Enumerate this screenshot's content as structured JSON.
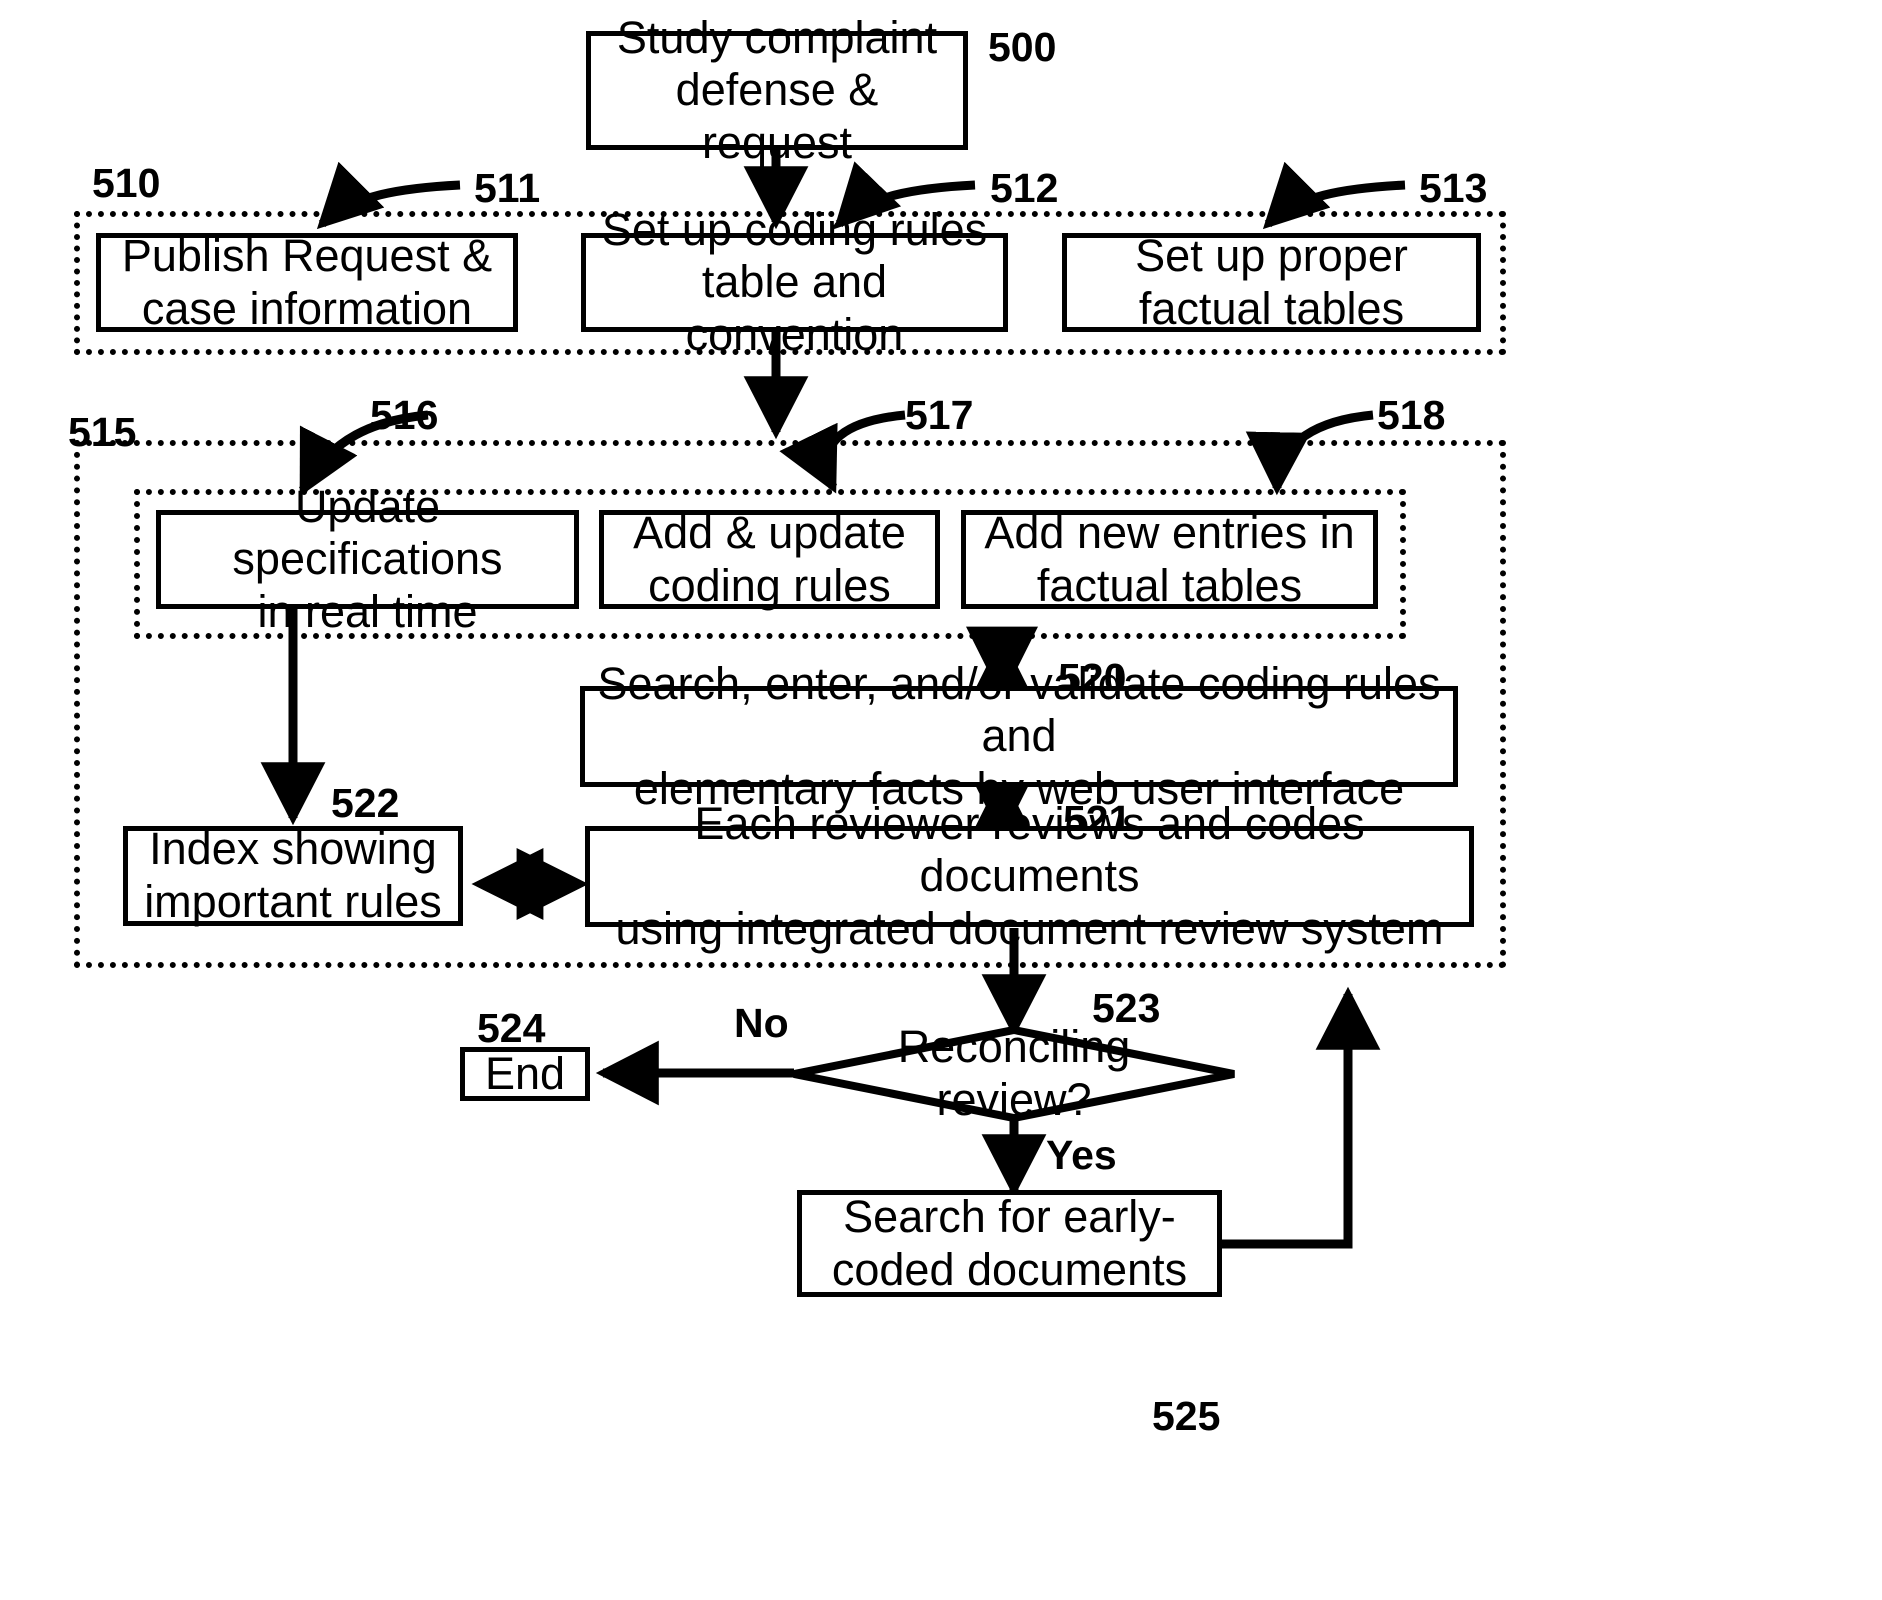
{
  "diagram": {
    "figure_number": "500",
    "nodes": {
      "start": {
        "ref": "500",
        "text": "Study complaint\ndefense & request"
      },
      "n511": {
        "ref": "511",
        "text": "Publish Request &\ncase information"
      },
      "n512": {
        "ref": "512",
        "text": "Set up coding rules\ntable and convention"
      },
      "n513": {
        "ref": "513",
        "text": "Set up proper\nfactual tables"
      },
      "n516": {
        "ref": "516",
        "text": "Update specifications\nin real time"
      },
      "n517": {
        "ref": "517",
        "text": "Add & update\ncoding rules"
      },
      "n518": {
        "ref": "518",
        "text": "Add new entries in\nfactual tables"
      },
      "n520": {
        "ref": "520",
        "text": "Search, enter, and/or validate coding rules and\nelementary facts by web user interface"
      },
      "n521": {
        "ref": "521",
        "text": "Each reviewer reviews and codes documents\nusing integrated document review system"
      },
      "n522": {
        "ref": "522",
        "text": "Index showing\nimportant rules"
      },
      "n523": {
        "ref": "523",
        "text": "Reconciling\nreview?"
      },
      "n524": {
        "ref": "524",
        "text": "End"
      },
      "n525": {
        "ref": "525",
        "text": "Search for early-\ncoded documents"
      }
    },
    "groups": {
      "g510": {
        "ref": "510"
      },
      "g515": {
        "ref": "515"
      }
    },
    "branches": {
      "no": "No",
      "yes": "Yes"
    }
  }
}
